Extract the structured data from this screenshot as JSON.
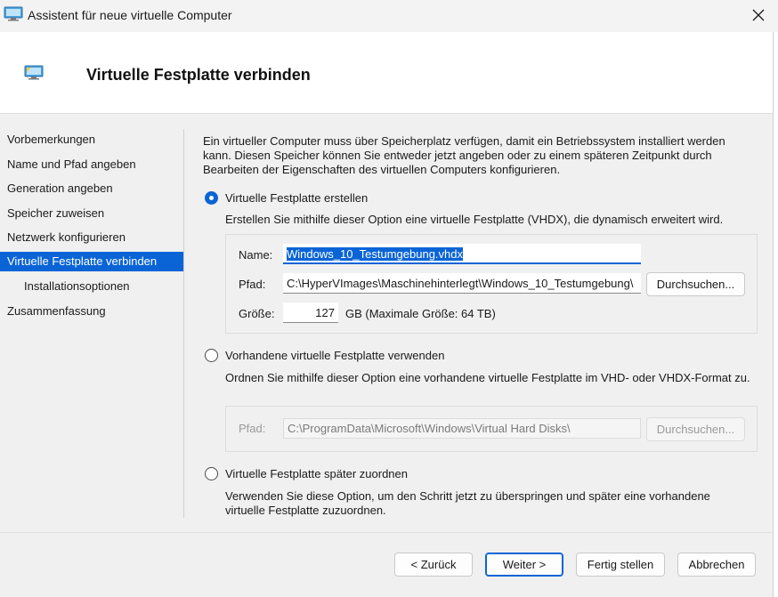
{
  "window": {
    "title": "Assistent für neue virtuelle Computer",
    "app_icon": "hyperv-monitor-icon",
    "close_icon": "close-icon"
  },
  "header": {
    "title": "Virtuelle Festplatte verbinden",
    "icon": "hyperv-monitor-icon"
  },
  "nav": {
    "items": [
      {
        "label": "Vorbemerkungen"
      },
      {
        "label": "Name und Pfad angeben"
      },
      {
        "label": "Generation angeben"
      },
      {
        "label": "Speicher zuweisen"
      },
      {
        "label": "Netzwerk konfigurieren"
      },
      {
        "label": "Virtuelle Festplatte verbinden",
        "active": true
      },
      {
        "label": "Installationsoptionen"
      },
      {
        "label": "Zusammenfassung"
      }
    ]
  },
  "intro": "Ein virtueller Computer muss über Speicherplatz verfügen, damit ein Betriebssystem installiert werden kann. Diesen Speicher können Sie entweder jetzt angeben oder zu einem späteren Zeitpunkt durch Bearbeiten der Eigenschaften des virtuellen Computers konfigurieren.",
  "option_create": {
    "label": "Virtuelle Festplatte erstellen",
    "checked": true,
    "description": "Erstellen Sie mithilfe dieser Option eine virtuelle Festplatte (VHDX), die dynamisch erweitert wird.",
    "name_label": "Name:",
    "name_value": "Windows_10_Testumgebung.vhdx",
    "path_label": "Pfad:",
    "path_value": "C:\\HyperVImages\\Maschinehinterlegt\\Windows_10_Testumgebung\\",
    "browse_label": "Durchsuchen...",
    "size_label": "Größe:",
    "size_value": "127",
    "size_unit": "GB (Maximale Größe: 64 TB)"
  },
  "option_existing": {
    "label": "Vorhandene virtuelle Festplatte verwenden",
    "checked": false,
    "description": "Ordnen Sie mithilfe dieser Option eine vorhandene virtuelle Festplatte im VHD- oder VHDX-Format zu.",
    "path_label": "Pfad:",
    "path_value": "C:\\ProgramData\\Microsoft\\Windows\\Virtual Hard Disks\\",
    "browse_label": "Durchsuchen..."
  },
  "option_later": {
    "label": "Virtuelle Festplatte später zuordnen",
    "checked": false,
    "description": "Verwenden Sie diese Option, um den Schritt jetzt zu überspringen und später eine vorhandene virtuelle Festplatte zuzuordnen."
  },
  "footer": {
    "back_label": "< Zurück",
    "next_label": "Weiter >",
    "finish_label": "Fertig stellen",
    "cancel_label": "Abbrechen"
  },
  "colors": {
    "accent": "#0a64d6",
    "background": "#f0f0f0",
    "header_bg": "#ffffff"
  }
}
